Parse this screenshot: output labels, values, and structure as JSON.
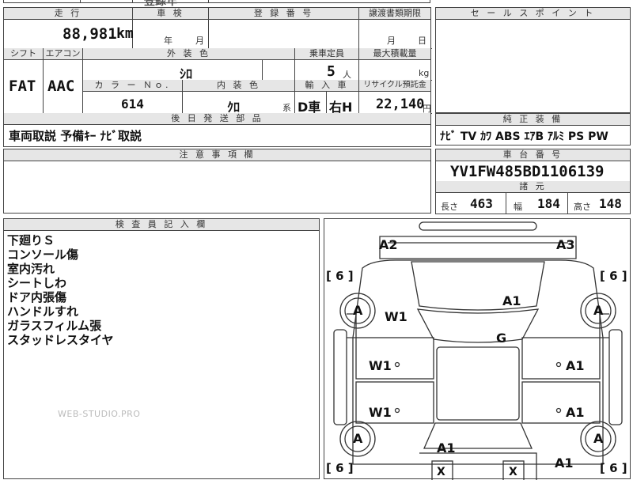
{
  "top_partial": {
    "ghost_text": "登録年"
  },
  "info": {
    "mileage_label": "走 行",
    "mileage_value": "88,981",
    "mileage_unit": "km",
    "shaken_label": "車 検",
    "shaken_year_unit": "年",
    "shaken_month_unit": "月",
    "reg_no_label": "登 録 番 号",
    "transfer_label": "譲渡書類期限",
    "transfer_month_unit": "月",
    "transfer_day_unit": "日",
    "shift_label": "シフト",
    "shift_value": "FAT",
    "aircon_label": "エアコン",
    "aircon_value": "AAC",
    "exterior_label": "外 装 色",
    "exterior_value": "ｼﾛ",
    "capacity_label": "乗車定員",
    "capacity_value": "5",
    "capacity_unit": "人",
    "max_load_label": "最大積載量",
    "max_load_unit": "kg",
    "color_no_label": "カ ラ ー Ｎｏ.",
    "color_no_value": "614",
    "interior_label": "内 装 色",
    "interior_value": "ｸﾛ",
    "interior_unit": "系",
    "import_label": "輸 入 車",
    "import_value": "D車",
    "handle_value": "右H",
    "recycle_label": "リサイクル預託金",
    "recycle_value": "22,140",
    "recycle_unit": "円",
    "later_parts_label": "後 日 発 送 部 品",
    "later_parts_value": "車両取説 予備ｷｰ ﾅﾋﾞ取説",
    "notice_label": "注 意 事 項 欄"
  },
  "selling_points": {
    "label": "セ ー ル ス ポ イ ン ト"
  },
  "equipment": {
    "label": "純 正 装 備",
    "items": "ﾅﾋﾞ TV ｶﾜ ABS ｴｱB ｱﾙﾐ PS PW"
  },
  "chassis": {
    "label": "車 台 番 号",
    "value": "YV1FW485BD1106139",
    "specs_label": "諸 元",
    "length_label": "長さ",
    "length_value": "463",
    "width_label": "幅",
    "width_value": "184",
    "height_label": "高さ",
    "height_value": "148"
  },
  "inspector": {
    "label": "検 査 員 記 入 欄",
    "notes": [
      "下廻りＳ",
      "コンソール傷",
      "室内汚れ",
      "シートしわ",
      "ドア内張傷",
      "ハンドルすれ",
      "ガラスフィルム張",
      "スタッドレスタイヤ"
    ],
    "watermark": "WEB-STUDIO.PRO"
  },
  "diagram": {
    "marks": {
      "a2": "A2",
      "a3": "A3",
      "a1_hood": "A1",
      "w1_wind": "W1",
      "g": "G",
      "w1_door_fl": "W1",
      "w1_door_rl": "W1",
      "a1_door_fr": "A1",
      "a1_door_rr": "A1",
      "a1_rear_l": "A1",
      "a1_rear_r": "A1",
      "tire_fl": "A",
      "tire_fr": "A",
      "tire_rl": "A",
      "tire_rr": "A",
      "x_left": "X",
      "x_right": "X"
    },
    "brackets": {
      "fl": "6",
      "fr": "6",
      "rl": "6",
      "rr": "6"
    }
  }
}
